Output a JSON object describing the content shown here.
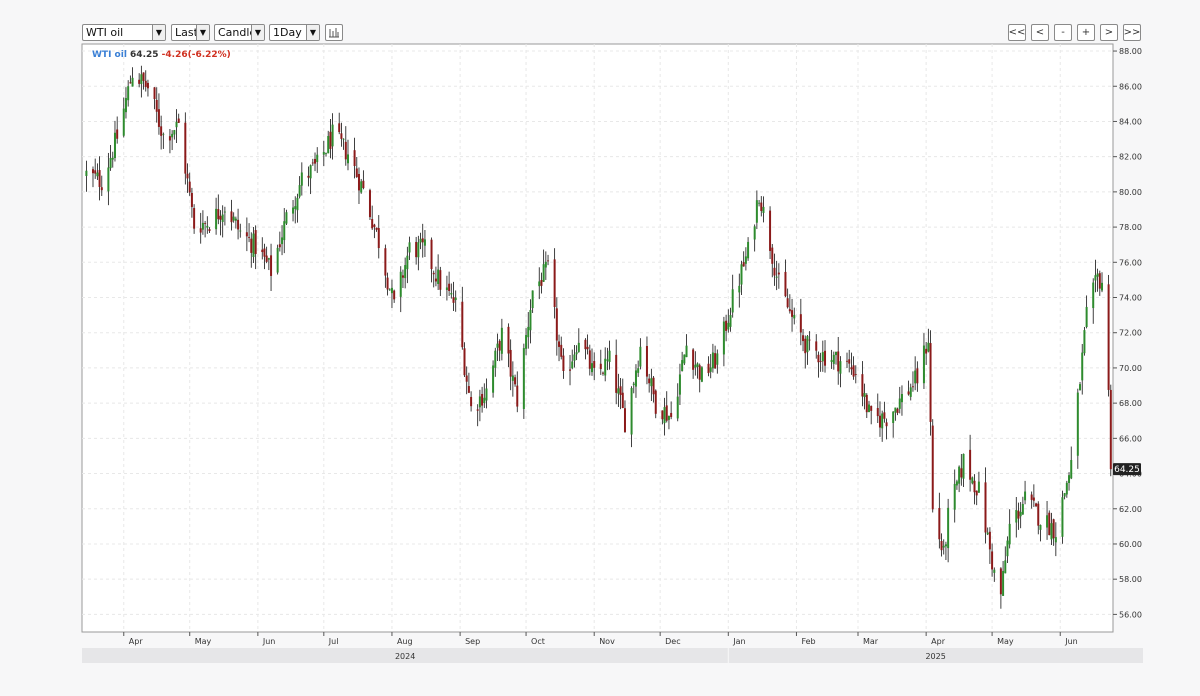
{
  "toolbar": {
    "symbol": "WTI oil",
    "price_type": "Last",
    "chart_type": "Candle",
    "interval": "1Day",
    "nav": [
      "<<",
      "<",
      "-",
      "+",
      ">",
      ">>"
    ]
  },
  "legend": {
    "symbol": "WTI oil",
    "last": "64.25",
    "change": "-4.26(-6.22%)",
    "symbol_color": "#3a7fd5",
    "change_color": "#d03020"
  },
  "price_tag": "64.25",
  "colors": {
    "up": "#2e8b2e",
    "down": "#8b1a1a",
    "wick": "#111111",
    "tag_bg": "#222222"
  },
  "chart_data": {
    "type": "candlestick",
    "title": "",
    "xlabel": "",
    "ylabel": "",
    "ylim": [
      55,
      88.4
    ],
    "y_ticks": [
      "88.00",
      "86.00",
      "84.00",
      "82.00",
      "80.00",
      "78.00",
      "76.00",
      "74.00",
      "72.00",
      "70.00",
      "68.00",
      "66.00",
      "64.00",
      "62.00",
      "60.00",
      "58.00",
      "56.00"
    ],
    "month_labels": [
      "Apr",
      "May",
      "Jun",
      "Jul",
      "Aug",
      "Sep",
      "Oct",
      "Nov",
      "Dec",
      "Jan",
      "Feb",
      "Mar",
      "Apr",
      "May",
      "Jun"
    ],
    "year_labels": [
      "2024",
      "2025"
    ],
    "grid": true,
    "legend_position": "top-left",
    "series": [
      {
        "points": [
          {
            "t": "2024-03-15",
            "c": 81.0
          },
          {
            "t": "2024-03-22",
            "c": 80.6
          },
          {
            "t": "2024-03-29",
            "c": 83.1
          },
          {
            "t": "2024-04-05",
            "c": 86.8
          },
          {
            "t": "2024-04-12",
            "c": 85.9
          },
          {
            "t": "2024-04-19",
            "c": 83.2
          },
          {
            "t": "2024-04-26",
            "c": 83.8
          },
          {
            "t": "2024-05-03",
            "c": 78.1
          },
          {
            "t": "2024-05-10",
            "c": 78.3
          },
          {
            "t": "2024-05-17",
            "c": 79.2
          },
          {
            "t": "2024-05-24",
            "c": 77.7
          },
          {
            "t": "2024-05-31",
            "c": 76.9
          },
          {
            "t": "2024-06-07",
            "c": 75.5
          },
          {
            "t": "2024-06-14",
            "c": 78.5
          },
          {
            "t": "2024-06-21",
            "c": 80.7
          },
          {
            "t": "2024-06-28",
            "c": 81.5
          },
          {
            "t": "2024-07-05",
            "c": 83.2
          },
          {
            "t": "2024-07-12",
            "c": 82.2
          },
          {
            "t": "2024-07-19",
            "c": 80.1
          },
          {
            "t": "2024-07-26",
            "c": 77.2
          },
          {
            "t": "2024-08-02",
            "c": 73.5
          },
          {
            "t": "2024-08-09",
            "c": 76.8
          },
          {
            "t": "2024-08-16",
            "c": 76.7
          },
          {
            "t": "2024-08-23",
            "c": 74.8
          },
          {
            "t": "2024-08-30",
            "c": 73.6
          },
          {
            "t": "2024-09-06",
            "c": 67.7
          },
          {
            "t": "2024-09-13",
            "c": 68.7
          },
          {
            "t": "2024-09-20",
            "c": 71.9
          },
          {
            "t": "2024-09-27",
            "c": 68.2
          },
          {
            "t": "2024-10-04",
            "c": 74.4
          },
          {
            "t": "2024-10-11",
            "c": 75.6
          },
          {
            "t": "2024-10-18",
            "c": 69.2
          },
          {
            "t": "2024-10-25",
            "c": 71.8
          },
          {
            "t": "2024-11-01",
            "c": 69.5
          },
          {
            "t": "2024-11-08",
            "c": 70.4
          },
          {
            "t": "2024-11-15",
            "c": 67.0
          },
          {
            "t": "2024-11-22",
            "c": 71.2
          },
          {
            "t": "2024-11-29",
            "c": 68.0
          },
          {
            "t": "2024-12-06",
            "c": 67.2
          },
          {
            "t": "2024-12-13",
            "c": 71.3
          },
          {
            "t": "2024-12-20",
            "c": 69.5
          },
          {
            "t": "2024-12-27",
            "c": 70.6
          },
          {
            "t": "2025-01-03",
            "c": 73.9
          },
          {
            "t": "2025-01-10",
            "c": 76.6
          },
          {
            "t": "2025-01-15",
            "c": 80.0
          },
          {
            "t": "2025-01-24",
            "c": 74.7
          },
          {
            "t": "2025-01-31",
            "c": 72.5
          },
          {
            "t": "2025-02-07",
            "c": 71.0
          },
          {
            "t": "2025-02-14",
            "c": 70.7
          },
          {
            "t": "2025-02-21",
            "c": 70.4
          },
          {
            "t": "2025-02-28",
            "c": 69.8
          },
          {
            "t": "2025-03-07",
            "c": 67.0
          },
          {
            "t": "2025-03-14",
            "c": 67.2
          },
          {
            "t": "2025-03-21",
            "c": 68.3
          },
          {
            "t": "2025-03-28",
            "c": 69.4
          },
          {
            "t": "2025-04-02",
            "c": 71.7
          },
          {
            "t": "2025-04-04",
            "c": 61.9
          },
          {
            "t": "2025-04-09",
            "c": 59.3
          },
          {
            "t": "2025-04-11",
            "c": 61.5
          },
          {
            "t": "2025-04-18",
            "c": 64.7
          },
          {
            "t": "2025-04-25",
            "c": 63.0
          },
          {
            "t": "2025-05-02",
            "c": 58.3
          },
          {
            "t": "2025-05-05",
            "c": 57.1
          },
          {
            "t": "2025-05-09",
            "c": 61.0
          },
          {
            "t": "2025-05-16",
            "c": 62.5
          },
          {
            "t": "2025-05-23",
            "c": 61.5
          },
          {
            "t": "2025-05-30",
            "c": 60.8
          },
          {
            "t": "2025-06-06",
            "c": 64.6
          },
          {
            "t": "2025-06-13",
            "c": 72.9
          },
          {
            "t": "2025-06-18",
            "c": 75.1
          },
          {
            "t": "2025-06-20",
            "c": 74.9
          },
          {
            "t": "2025-06-23",
            "c": 68.5
          },
          {
            "t": "2025-06-24",
            "c": 64.25
          }
        ]
      }
    ]
  }
}
